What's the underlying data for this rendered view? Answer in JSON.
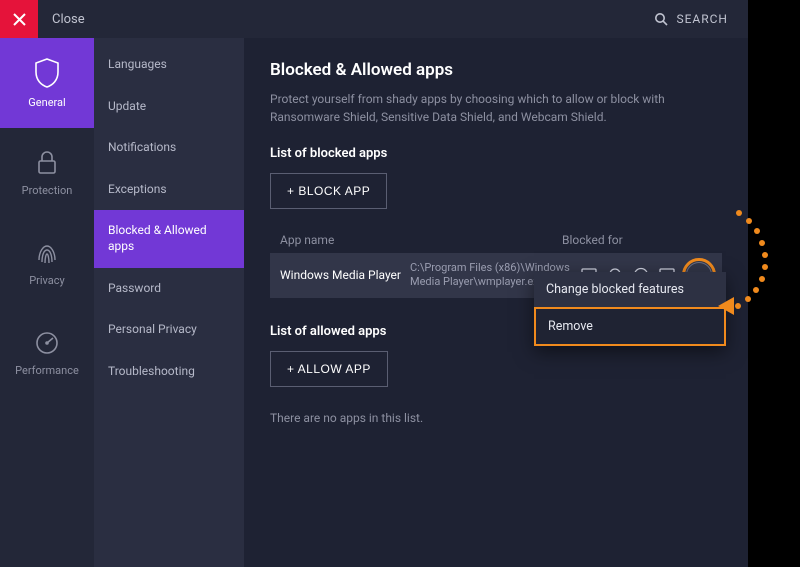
{
  "topbar": {
    "close_label": "Close",
    "search_label": "SEARCH"
  },
  "rail": {
    "items": [
      {
        "label": "General"
      },
      {
        "label": "Protection"
      },
      {
        "label": "Privacy"
      },
      {
        "label": "Performance"
      }
    ]
  },
  "secnav": {
    "items": [
      {
        "label": "Languages"
      },
      {
        "label": "Update"
      },
      {
        "label": "Notifications"
      },
      {
        "label": "Exceptions"
      },
      {
        "label": "Blocked & Allowed apps"
      },
      {
        "label": "Password"
      },
      {
        "label": "Personal Privacy"
      },
      {
        "label": "Troubleshooting"
      }
    ]
  },
  "main": {
    "title": "Blocked & Allowed apps",
    "description": "Protect yourself from shady apps by choosing which to allow or block with Ransomware Shield, Sensitive Data Shield, and Webcam Shield.",
    "blocked": {
      "heading": "List of blocked apps",
      "button": "+ BLOCK APP",
      "col_name": "App name",
      "col_for": "Blocked for",
      "row": {
        "name": "Windows Media Player",
        "path": "C:\\Program Files (x86)\\Windows Media Player\\wmplayer.exe"
      }
    },
    "allowed": {
      "heading": "List of allowed apps",
      "button": "+ ALLOW APP",
      "empty": "There are no apps in this list."
    }
  },
  "popup": {
    "change": "Change blocked features",
    "remove": "Remove"
  }
}
